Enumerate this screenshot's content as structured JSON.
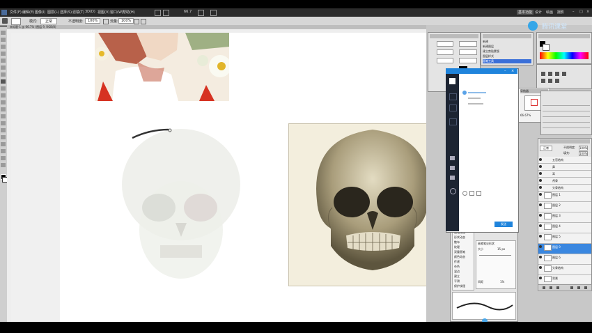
{
  "menubar": {
    "items": [
      "文件(F)",
      "编辑(E)",
      "图像(I)",
      "图层(L)",
      "选择(S)",
      "滤镜(T)",
      "3D(D)",
      "视图(V)",
      "窗口(W)",
      "帮助(H)"
    ],
    "zoom": "66.7",
    "workspace_tabs": [
      "基本功能",
      "设计",
      "绘画",
      "摄影"
    ]
  },
  "options": {
    "mode_label": "模式:",
    "mode_value": "正常",
    "opacity_label": "不透明度:",
    "opacity_value": "100%",
    "flow_label": "流量:",
    "flow_value": "100%"
  },
  "document": {
    "tab_label": "未标题-1 @ 66.7% (图层 9, RGB/8)"
  },
  "nav": {
    "title": "导航器",
    "zoom": "66.67%"
  },
  "history": {
    "items": [
      "新建",
      "新建图层",
      "建立剪贴蒙版",
      "图层样式",
      "画笔工具"
    ]
  },
  "layers": {
    "blend": "正常",
    "opacity_label": "不透明度:",
    "opacity_value": "100%",
    "fill_label": "填充:",
    "fill_value": "100%",
    "items": [
      "五官结构",
      "鼻",
      "耳",
      "颅骨",
      "头骨结构",
      "图层 1",
      "图层 2",
      "图层 3",
      "图层 4",
      "图层 5",
      "图层 9",
      "图层 6",
      "头骨结构",
      "图层 7",
      "背景"
    ]
  },
  "qq": {
    "title": "",
    "panel_button": "发送"
  },
  "brush_panel": {
    "title": "画笔笔尖形状",
    "items": [
      "画笔预设",
      "形状动态",
      "散布",
      "纹理",
      "双重画笔",
      "颜色动态",
      "传递",
      "杂色",
      "湿边",
      "建立",
      "平滑",
      "保护纹理"
    ],
    "size_label": "大小",
    "size_value": "15 px",
    "spacing_label": "间距",
    "spacing_value": "1%"
  },
  "brand": {
    "logo_text": "腾讯课堂"
  },
  "colors": {
    "menubar": "#2b2b2b",
    "accent": "#1f84dc",
    "canvas": "#ffffff"
  }
}
